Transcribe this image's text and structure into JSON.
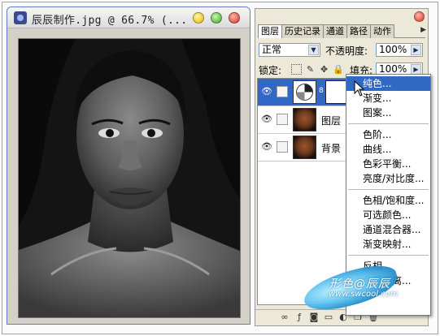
{
  "document": {
    "title": "辰辰制作.jpg @ 66.7% (...",
    "image_description": "black-and-white portrait photo"
  },
  "panel": {
    "tabs": [
      "图层",
      "历史记录",
      "通道",
      "路径",
      "动作"
    ],
    "blend_mode": "正常",
    "opacity_label": "不透明度:",
    "opacity_value": "100%",
    "lock_label": "锁定:",
    "fill_label": "填充:",
    "fill_value": "100%",
    "layers": [
      {
        "name": "",
        "type": "adjustment",
        "selected": true
      },
      {
        "name": "图层",
        "type": "image",
        "selected": false
      },
      {
        "name": "背景",
        "type": "image",
        "selected": false
      }
    ]
  },
  "menu": {
    "items": [
      {
        "label": "纯色...",
        "highlighted": true
      },
      {
        "label": "渐变..."
      },
      {
        "label": "图案..."
      },
      {
        "sep": true
      },
      {
        "label": "色阶..."
      },
      {
        "label": "曲线..."
      },
      {
        "label": "色彩平衡..."
      },
      {
        "label": "亮度/对比度..."
      },
      {
        "sep": true
      },
      {
        "label": "色相/饱和度..."
      },
      {
        "label": "可选颜色..."
      },
      {
        "label": "通道混合器..."
      },
      {
        "label": "渐变映射..."
      },
      {
        "sep": true
      },
      {
        "label": "反相"
      },
      {
        "label": "色调分离..."
      }
    ]
  },
  "watermark": {
    "line1": "形色@辰辰",
    "line2": "www.swcool.com"
  },
  "colors": {
    "selection": "#3168c6",
    "menu_highlight": "#316ac5",
    "panel_bg": "#ece9d8"
  }
}
